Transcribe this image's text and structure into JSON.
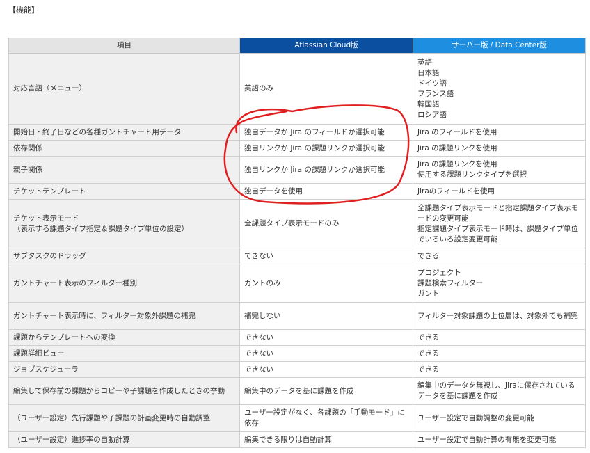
{
  "title": "【機能】",
  "headers": [
    "項目",
    "Atlassian Cloud版",
    "サーバー版 / Data Center版"
  ],
  "rows": [
    {
      "item": "対応言語（メニュー）",
      "cloud": "英語のみ",
      "server": "英語\n日本語\nドイツ語\nフランス語\n韓国語\nロシア語",
      "h": 102
    },
    {
      "item": "開始日・終了日などの各種ガントチャート用データ",
      "cloud": "独自データか Jira のフィールドか選択可能",
      "server": "Jira のフィールドを使用",
      "h": 23
    },
    {
      "item": "依存関係",
      "cloud": "独自リンクか Jira の課題リンクか選択可能",
      "server": "Jira の課題リンクを使用",
      "h": 23
    },
    {
      "item": "親子関係",
      "cloud": "独自リンクか Jira の課題リンクか選択可能",
      "server": "Jira の課題リンクを使用\n使用する課題リンクタイプを選択",
      "h": 39
    },
    {
      "item": "チケットテンプレート",
      "cloud": "独自データを使用",
      "server": "Jiraのフィールドを使用",
      "h": 23
    },
    {
      "item": "チケット表示モード\n（表示する課題タイプ指定＆課題タイプ単位の設定）",
      "cloud": "全課題タイプ表示モードのみ",
      "server": "全課題タイプ表示モードと指定課題タイプ表示モードの変更可能\n指定課題タイプ表示モード時は、課題タイプ単位でいろいろ設定変更可能",
      "h": 70
    },
    {
      "item": "サブタスクのドラッグ",
      "cloud": "できない",
      "server": "できる",
      "h": 23
    },
    {
      "item": "ガントチャート表示のフィルター種別",
      "cloud": "ガントのみ",
      "server": "プロジェクト\n課題検索フィルター\nガント",
      "h": 55
    },
    {
      "item": "ガントチャート表示時に、フィルター対象外課題の補完",
      "cloud": "補完しない",
      "server": "フィルター対象課題の上位層は、対象外でも補完",
      "h": 39
    },
    {
      "item": "課題からテンプレートへの変換",
      "cloud": "できない",
      "server": "できる",
      "h": 23
    },
    {
      "item": "課題詳細ビュー",
      "cloud": "できない",
      "server": "できる",
      "h": 23
    },
    {
      "item": "ジョブスケジューラ",
      "cloud": "できない",
      "server": "できる",
      "h": 23
    },
    {
      "item": "編集して保存前の課題からコピーや子課題を作成したときの挙動",
      "cloud": "編集中のデータを基に課題を作成",
      "server": "編集中のデータを無視し、Jiraに保存されているデータを基に課題を作成",
      "h": 39
    },
    {
      "item": "（ユーザー設定）先行課題や子課題の計画変更時の自動調整",
      "cloud": "ユーザー設定がなく、各課題の「手動モード」に依存",
      "server": "ユーザー設定で自動調整の変更可能",
      "h": 39
    },
    {
      "item": "（ユーザー設定）進捗率の自動計算",
      "cloud": "編集できる限りは自動計算",
      "server": "ユーザー設定で自動計算の有無を変更可能",
      "h": 23
    }
  ],
  "annotation": {
    "color": "#e02020"
  }
}
